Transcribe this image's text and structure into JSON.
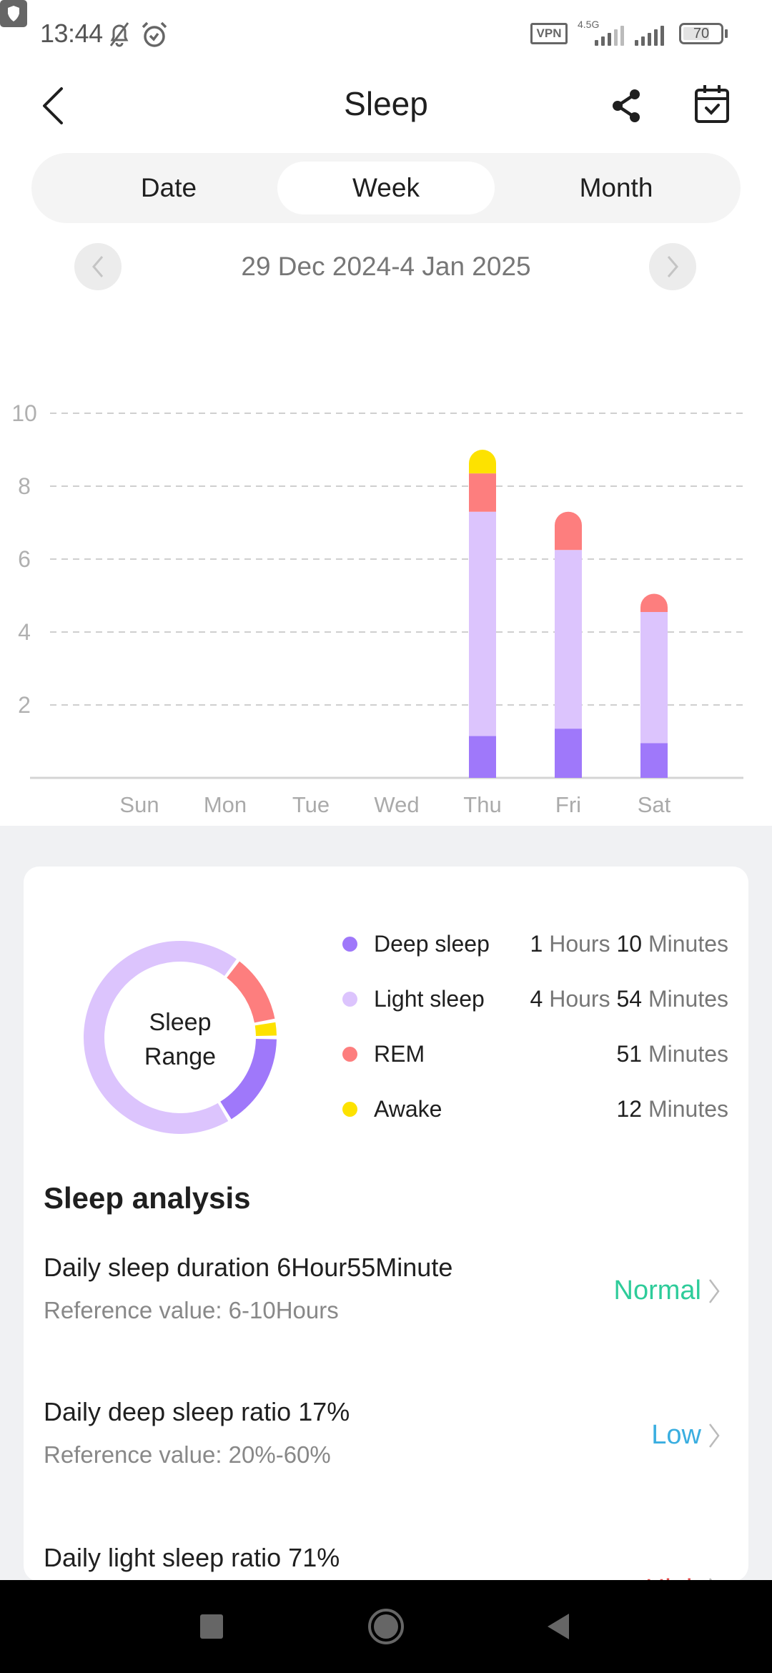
{
  "status_bar": {
    "time": "13:44",
    "icons": [
      "bell-off-icon",
      "alarm-icon",
      "shield-icon"
    ],
    "vpn_label": "VPN",
    "network_label": "4.5G",
    "battery": "70"
  },
  "header": {
    "title": "Sleep",
    "back_icon": "chevron-left-icon",
    "share_icon": "share-icon",
    "calendar_icon": "calendar-check-icon"
  },
  "tabs": [
    {
      "label": "Date",
      "active": false
    },
    {
      "label": "Week",
      "active": true
    },
    {
      "label": "Month",
      "active": false
    }
  ],
  "date_nav": {
    "range": "29 Dec 2024-4 Jan 2025",
    "prev_icon": "chevron-left-icon",
    "next_icon": "chevron-right-icon"
  },
  "colors": {
    "deep": "#9f78fa",
    "light": "#dcc4fd",
    "rem": "#fd7e7e",
    "awake": "#fde200",
    "normal": "#2ecc9a",
    "low": "#3aaee0",
    "high": "#e04848"
  },
  "chart_data": {
    "type": "bar",
    "stacked": true,
    "categories": [
      "Sun",
      "Mon",
      "Tue",
      "Wed",
      "Thu",
      "Fri",
      "Sat"
    ],
    "series": [
      {
        "name": "Deep sleep",
        "values": [
          0,
          0,
          0,
          0,
          1.15,
          1.35,
          0.95
        ]
      },
      {
        "name": "Light sleep",
        "values": [
          0,
          0,
          0,
          0,
          6.15,
          4.9,
          3.6
        ]
      },
      {
        "name": "REM",
        "values": [
          0,
          0,
          0,
          0,
          1.05,
          1.05,
          0.5
        ]
      },
      {
        "name": "Awake",
        "values": [
          0,
          0,
          0,
          0,
          0.65,
          0,
          0
        ]
      }
    ],
    "yticks": [
      "2",
      "4",
      "6",
      "8",
      "10"
    ],
    "ylim": [
      0,
      10
    ],
    "ylabel": "",
    "xlabel": "",
    "grid": true,
    "title": ""
  },
  "summary": {
    "center_label_1": "Sleep",
    "center_label_2": "Range",
    "items": [
      {
        "key": "deep",
        "name": "Deep sleep",
        "hours": "1",
        "hours_unit": "Hours",
        "minutes": "10",
        "minutes_unit": "Minutes",
        "total_minutes": 70
      },
      {
        "key": "light",
        "name": "Light sleep",
        "hours": "4",
        "hours_unit": "Hours",
        "minutes": "54",
        "minutes_unit": "Minutes",
        "total_minutes": 294
      },
      {
        "key": "rem",
        "name": "REM",
        "hours": "",
        "hours_unit": "",
        "minutes": "51",
        "minutes_unit": "Minutes",
        "total_minutes": 51
      },
      {
        "key": "awake",
        "name": "Awake",
        "hours": "",
        "hours_unit": "",
        "minutes": "12",
        "minutes_unit": "Minutes",
        "total_minutes": 12
      }
    ]
  },
  "analysis": {
    "title": "Sleep analysis",
    "items": [
      {
        "label": "Daily sleep duration",
        "value": "6Hour55Minute",
        "ref_label": "Reference value:",
        "ref_value": "6-10",
        "ref_unit": "Hours",
        "status": "Normal",
        "status_key": "normal"
      },
      {
        "label": "Daily deep sleep ratio",
        "value": "17%",
        "ref_label": "Reference value:",
        "ref_value": "20%-60%",
        "ref_unit": "",
        "status": "Low",
        "status_key": "low"
      },
      {
        "label": "Daily light sleep ratio",
        "value": "71%",
        "ref_label": "",
        "ref_value": "",
        "ref_unit": "",
        "status": "High",
        "status_key": "high"
      }
    ]
  },
  "nav_bar": {
    "recents_icon": "square-icon",
    "home_icon": "circle-home-icon",
    "back_icon": "triangle-back-icon"
  }
}
